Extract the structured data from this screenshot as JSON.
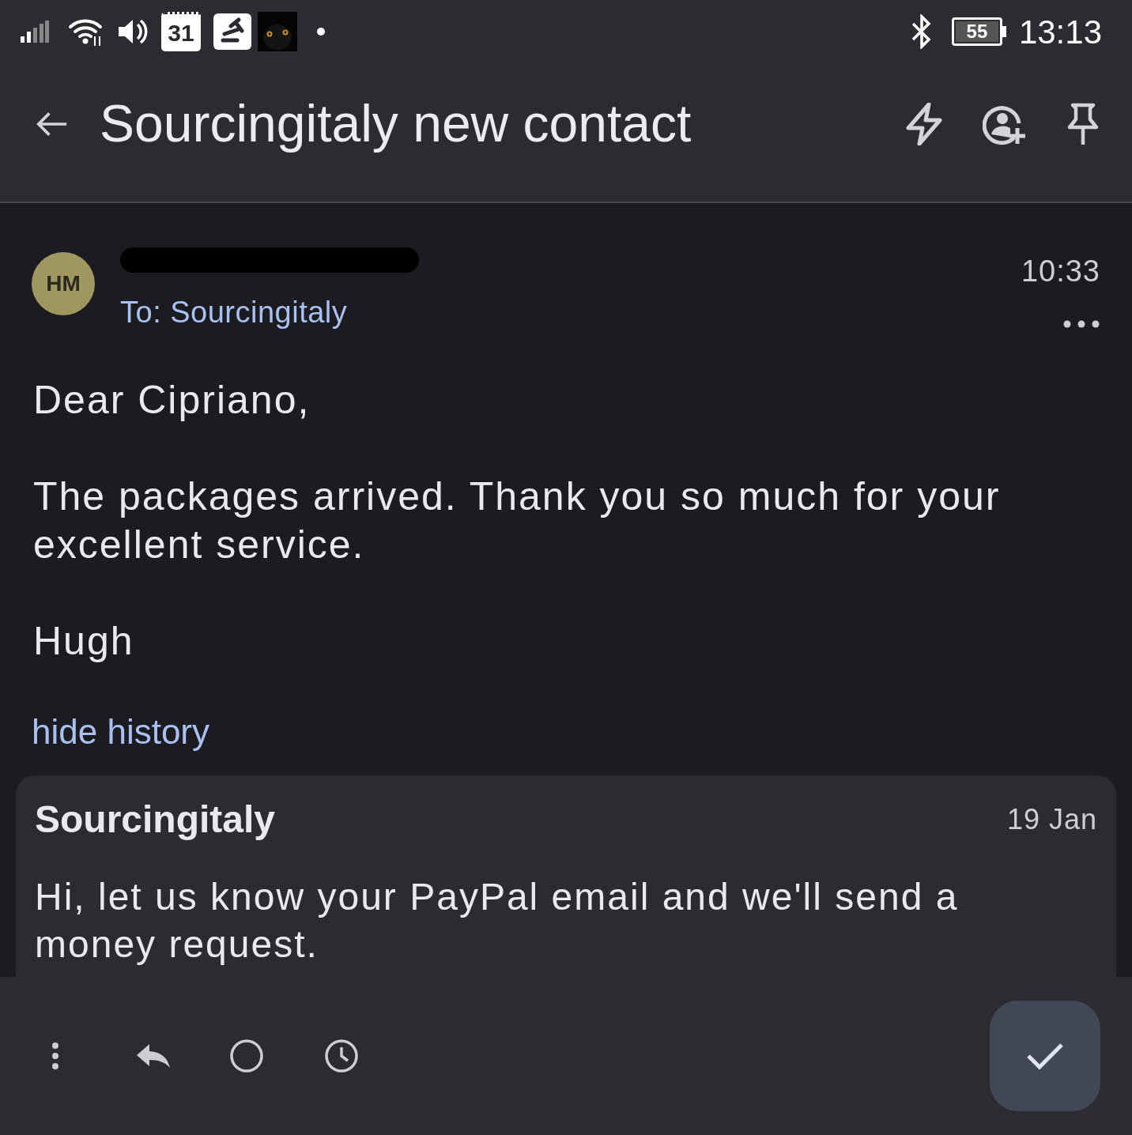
{
  "status_bar": {
    "calendar_day": "31",
    "battery": "55",
    "time": "13:13"
  },
  "header": {
    "title": "Sourcingitaly new contact"
  },
  "message": {
    "avatar": "HM",
    "recipient": "To: Sourcingitaly",
    "time": "10:33",
    "paragraphs": [
      "Dear Cipriano,",
      "The packages arrived. Thank you so much for your excellent service.",
      "Hugh"
    ]
  },
  "history_link": "hide history",
  "history": [
    {
      "sender": "Sourcingitaly",
      "date": "19 Jan",
      "body": "Hi, let us know your PayPal email and we'll send a money request."
    }
  ]
}
